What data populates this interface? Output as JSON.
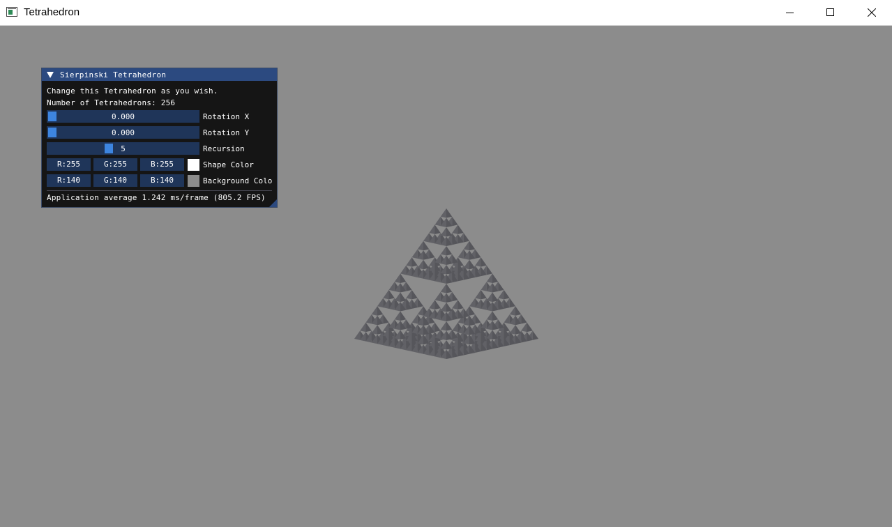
{
  "window": {
    "title": "Tetrahedron",
    "controls": [
      "minimize-icon",
      "maximize-icon",
      "close-icon"
    ]
  },
  "scene": {
    "background_color": "#8c8c8c",
    "shape_fill_color": "#5a5a5e",
    "object": "sierpinski-tetrahedron"
  },
  "panel": {
    "title": "Sierpinski Tetrahedron",
    "description": "Change this Tetrahedron as you wish.",
    "count_text": "Number of Tetrahedrons: 256",
    "rotation_x": {
      "value": "0.000",
      "label": "Rotation X",
      "fraction": 0.0
    },
    "rotation_y": {
      "value": "0.000",
      "label": "Rotation Y",
      "fraction": 0.0
    },
    "recursion": {
      "value": "5",
      "label": "Recursion",
      "fraction": 0.4
    },
    "shape_color": {
      "r": "R:255",
      "g": "G:255",
      "b": "B:255",
      "label": "Shape Color",
      "swatch": "#ffffff"
    },
    "background_color": {
      "r": "R:140",
      "g": "G:140",
      "b": "B:140",
      "label": "Background Colo",
      "swatch": "#8c8c8c"
    },
    "footer": "Application average 1.242 ms/frame (805.2 FPS)",
    "accent": "#3d85e0",
    "frame_color": "#1f3559",
    "header_color": "#2c4a80"
  }
}
